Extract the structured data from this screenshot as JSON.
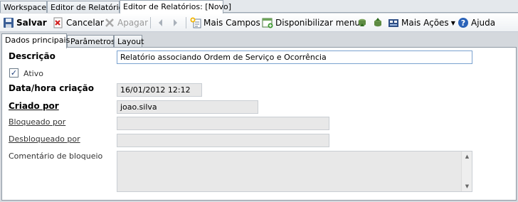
{
  "doc_tabs": [
    {
      "label": "Workspace"
    },
    {
      "label": "Editor de Relatórios"
    },
    {
      "label": "Editor de Relatórios: [Novo]"
    }
  ],
  "toolbar": {
    "save": "Salvar",
    "cancel": "Cancelar",
    "delete": "Apagar",
    "more_fields": "Mais Campos",
    "publish_menu": "Disponibilizar menu",
    "more_actions": "Mais Ações",
    "help": "Ajuda"
  },
  "inner_tabs": [
    {
      "label": "Dados principais"
    },
    {
      "label": "Parâmetros"
    },
    {
      "label": "Layout"
    }
  ],
  "form": {
    "descricao_label": "Descrição",
    "descricao_value": "Relatório associando Ordem de Serviço e Ocorrência",
    "ativo_label": "Ativo",
    "ativo_checked": true,
    "ativo_mark": "✓",
    "data_label": "Data/hora criação",
    "data_value": "16/01/2012 12:12",
    "criado_label": "Criado por",
    "criado_value": "joao.silva",
    "bloqueado_label": "Bloqueado por",
    "bloqueado_value": "",
    "desbloqueado_label": "Desbloqueado por",
    "desbloqueado_value": "",
    "comentario_label": "Comentário de bloqueio",
    "comentario_value": ""
  },
  "colors": {
    "accent": "#1e5fa8",
    "window_bg": "#d4d8dd",
    "readonly_bg": "#e8e8e8"
  }
}
